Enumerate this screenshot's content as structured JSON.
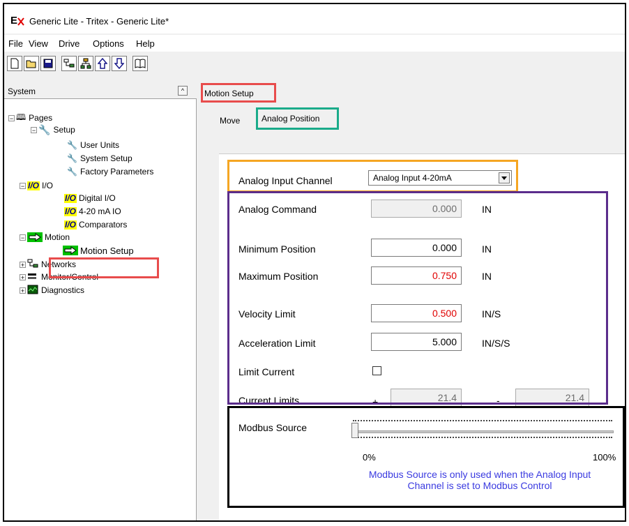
{
  "window": {
    "title": "Generic Lite - Tritex - Generic Lite*"
  },
  "menu": [
    "File",
    "View",
    "Drive",
    "Options",
    "Help"
  ],
  "toolbar_icons": [
    "new-file-icon",
    "open-folder-icon",
    "save-icon",
    "network-icon",
    "network-tree-icon",
    "upload-icon",
    "download-icon",
    "book-icon"
  ],
  "sidebar": {
    "title": "System",
    "collapse_glyph": "^",
    "tree": {
      "pages": "Pages",
      "setup": "Setup",
      "user_units": "User Units",
      "system_setup": "System Setup",
      "factory_parameters": "Factory Parameters",
      "io": "I/O",
      "digital_io": "Digital I/O",
      "ma_io": "4-20 mA IO",
      "comparators": "Comparators",
      "motion": "Motion",
      "motion_setup": "Motion Setup",
      "networks": "Networks",
      "monitor_control": "Monitor/Control",
      "diagnostics": "Diagnostics"
    },
    "io_glyph": "I/O"
  },
  "content": {
    "tab_header": "Motion Setup",
    "subtabs": {
      "move": "Move",
      "analog_position": "Analog Position"
    },
    "analog_input_channel": {
      "label": "Analog Input Channel",
      "value": "Analog Input 4-20mA"
    },
    "analog_command": {
      "label": "Analog Command",
      "value": "0.000",
      "unit": "IN"
    },
    "minimum_position": {
      "label": "Minimum Position",
      "value": "0.000",
      "unit": "IN"
    },
    "maximum_position": {
      "label": "Maximum Position",
      "value": "0.750",
      "unit": "IN"
    },
    "velocity_limit": {
      "label": "Velocity Limit",
      "value": "0.500",
      "unit": "IN/S"
    },
    "acceleration_limit": {
      "label": "Acceleration Limit",
      "value": "5.000",
      "unit": "IN/S/S"
    },
    "limit_current": {
      "label": "Limit Current",
      "checked": false
    },
    "current_limits": {
      "label": "Current Limits",
      "plus_sign": "+",
      "plus_value": "21.4",
      "minus_sign": "-",
      "minus_value": "21.4"
    },
    "modbus_source": {
      "label": "Modbus Source",
      "min_label": "0%",
      "max_label": "100%",
      "level": 0,
      "note": "Modbus Source is only used when the Analog Input Channel is set to Modbus Control"
    }
  },
  "colors": {
    "highlight_red": "#e84c4c",
    "highlight_teal": "#1aab8a",
    "highlight_orange": "#f5a623",
    "highlight_purple": "#5b2d8c",
    "highlight_black": "#000000",
    "value_red": "#e00000",
    "note_blue": "#3a3ae0"
  }
}
